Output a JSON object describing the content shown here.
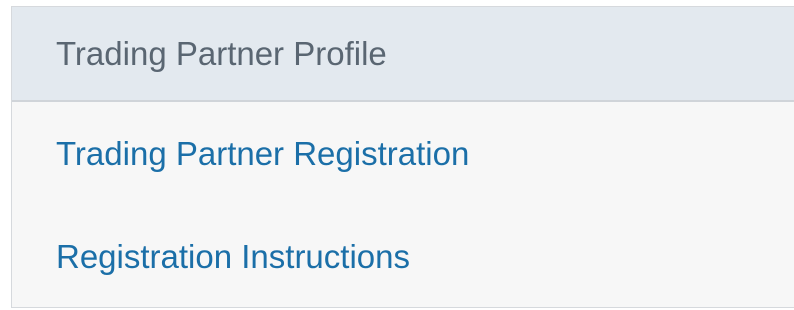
{
  "panel": {
    "title": "Trading Partner Profile",
    "items": [
      {
        "label": "Trading Partner Registration"
      },
      {
        "label": "Registration Instructions"
      }
    ]
  },
  "colors": {
    "header_bg": "#e3e9ef",
    "body_bg": "#f7f7f7",
    "title_text": "#5a6672",
    "link_text": "#1b6fa8"
  }
}
